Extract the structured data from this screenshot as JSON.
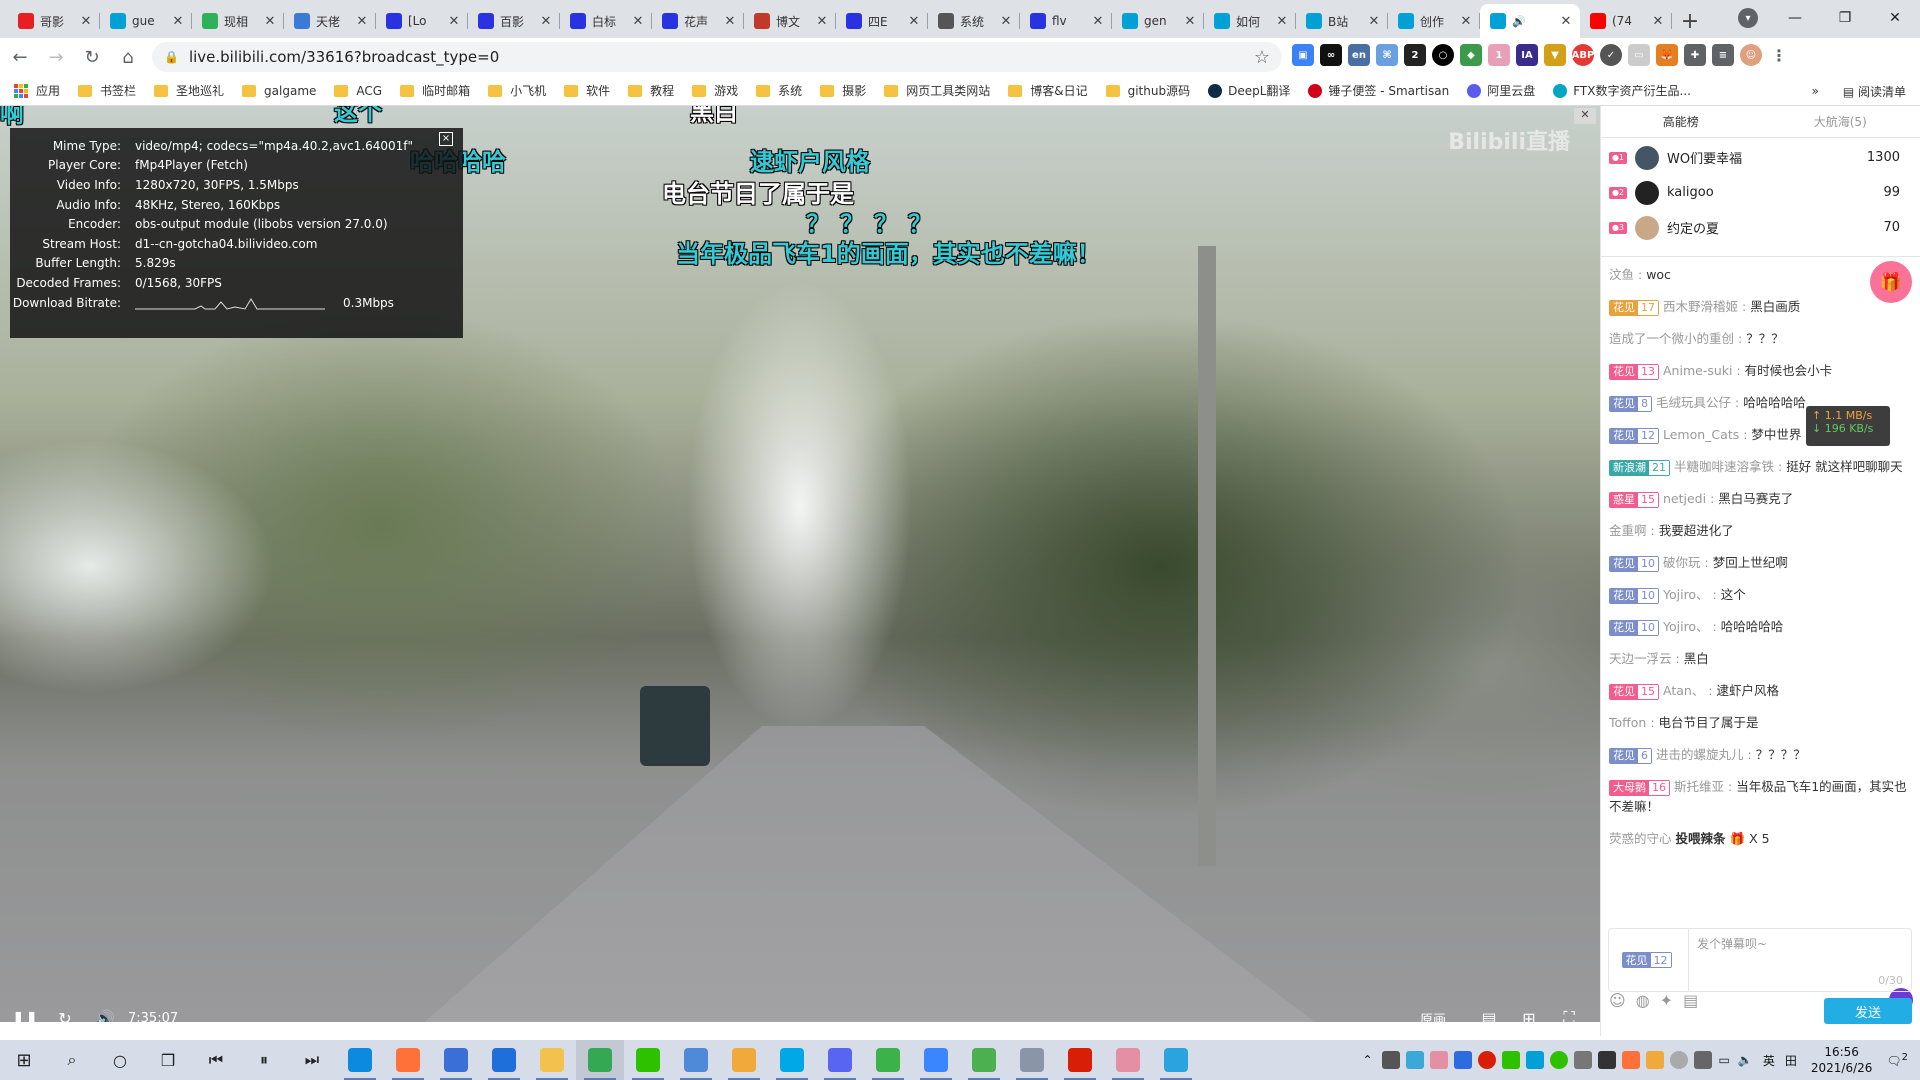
{
  "browser": {
    "tabs": [
      {
        "title": "哥影",
        "favicon": "#e81e25"
      },
      {
        "title": "gue",
        "favicon": "#00a1d6"
      },
      {
        "title": "现相",
        "favicon": "#2fb15b"
      },
      {
        "title": "天佬",
        "favicon": "#3a7bd5"
      },
      {
        "title": "[Lo",
        "favicon": "#2932e1"
      },
      {
        "title": "百影",
        "favicon": "#2932e1"
      },
      {
        "title": "白标",
        "favicon": "#2932e1"
      },
      {
        "title": "花声",
        "favicon": "#2932e1"
      },
      {
        "title": "博文",
        "favicon": "#c0392b"
      },
      {
        "title": "四E",
        "favicon": "#2932e1"
      },
      {
        "title": "系统",
        "favicon": "#555555"
      },
      {
        "title": "flv",
        "favicon": "#2932e1"
      },
      {
        "title": "gen",
        "favicon": "#00a1d6"
      },
      {
        "title": "如何",
        "favicon": "#00a1d6"
      },
      {
        "title": "B站",
        "favicon": "#00a1d6"
      },
      {
        "title": "创作",
        "favicon": "#00a1d6"
      },
      {
        "title": "",
        "favicon": "#00a1d6",
        "active": true
      },
      {
        "title": "(74",
        "favicon": "#ff0000"
      }
    ],
    "url": "live.bilibili.com/33616?broadcast_type=0",
    "extension_badges": [
      "en",
      "2",
      "1"
    ],
    "bookmarks": [
      {
        "label": "应用",
        "type": "apps"
      },
      {
        "label": "书签栏",
        "type": "folder"
      },
      {
        "label": "圣地巡礼",
        "type": "folder"
      },
      {
        "label": "galgame",
        "type": "folder"
      },
      {
        "label": "ACG",
        "type": "folder"
      },
      {
        "label": "临时邮箱",
        "type": "folder"
      },
      {
        "label": "小飞机",
        "type": "folder"
      },
      {
        "label": "软件",
        "type": "folder"
      },
      {
        "label": "教程",
        "type": "folder"
      },
      {
        "label": "游戏",
        "type": "folder"
      },
      {
        "label": "系统",
        "type": "folder"
      },
      {
        "label": "摄影",
        "type": "folder"
      },
      {
        "label": "网页工具类网站",
        "type": "folder"
      },
      {
        "label": "博客&日记",
        "type": "folder"
      },
      {
        "label": "github源码",
        "type": "folder"
      },
      {
        "label": "DeepL翻译",
        "type": "site",
        "color": "#0f2b46"
      },
      {
        "label": "锤子便签 - Smartisan",
        "type": "site",
        "color": "#d0021b"
      },
      {
        "label": "阿里云盘",
        "type": "site",
        "color": "#5b5bf0"
      },
      {
        "label": "FTX数字资产衍生品...",
        "type": "site",
        "color": "#02a6c2"
      }
    ],
    "reading_list_label": "阅读清单",
    "more_label": "»"
  },
  "player": {
    "stats": [
      {
        "key": "Mime Type:",
        "value": "video/mp4; codecs=\"mp4a.40.2,avc1.64001f\""
      },
      {
        "key": "Player Core:",
        "value": "fMp4Player (Fetch)"
      },
      {
        "key": "Video Info:",
        "value": "1280x720, 30FPS, 1.5Mbps"
      },
      {
        "key": "Audio Info:",
        "value": "48KHz, Stereo, 160Kbps"
      },
      {
        "key": "Encoder:",
        "value": "obs-output module (libobs version 27.0.0)"
      },
      {
        "key": "Stream Host:",
        "value": "d1--cn-gotcha04.bilivideo.com"
      },
      {
        "key": "Buffer Length:",
        "value": "5.829s"
      },
      {
        "key": "Decoded Frames:",
        "value": "0/1568, 30FPS"
      }
    ],
    "download_bitrate_label": "Download Bitrate:",
    "download_bitrate_value": "0.3Mbps",
    "stats_close": "[x]",
    "watermark": "Bilibili直播",
    "danmaku": [
      {
        "text": "啊",
        "color": "cyan"
      },
      {
        "text": "这个",
        "color": "cyan"
      },
      {
        "text": "黑白",
        "color": "white"
      },
      {
        "text": "哈哈哈哈",
        "color": "cyan"
      },
      {
        "text": "逮虾户风格",
        "color": "cyan"
      },
      {
        "text": "电台节目了属于是",
        "color": "white"
      },
      {
        "text": "？？？？",
        "color": "cyan"
      },
      {
        "text": "当年极品飞车1的画面，其实也不差嘛！",
        "color": "cyan"
      }
    ],
    "time": "7:35:07",
    "quality_label": "原画"
  },
  "side_panel": {
    "rank_tabs": [
      "高能榜",
      "大航海(5)"
    ],
    "rank": [
      {
        "name": "WO们要幸福",
        "score": "1300",
        "avatar": "#445566"
      },
      {
        "name": "kaligoo",
        "score": "99",
        "avatar": "#222222"
      },
      {
        "name": "约定の夏",
        "score": "70",
        "avatar": "#c9a88a"
      }
    ],
    "messages": [
      {
        "user": "汶鱼",
        "text": "woc"
      },
      {
        "medal": "花见",
        "level": "17",
        "medal_style": "orange",
        "user": "西木野滑稽姬",
        "text": "黑白画质"
      },
      {
        "user": "造成了一个微小的重创",
        "text": "？？？"
      },
      {
        "medal": "花见",
        "level": "13",
        "medal_style": "pink",
        "user": "Anime-suki",
        "text": "有时候也会小卡"
      },
      {
        "medal": "花见",
        "level": "8",
        "medal_style": "blue",
        "user": "毛绒玩具公仔",
        "text": "哈哈哈哈哈"
      },
      {
        "medal": "花见",
        "level": "12",
        "medal_style": "blue",
        "user": "Lemon_Cats",
        "text": "梦中世界"
      },
      {
        "medal": "新浪潮",
        "level": "21",
        "medal_style": "teal",
        "user": "半糖咖啡速溶拿铁",
        "text": "挺好 就这样吧聊聊天"
      },
      {
        "medal": "惑星",
        "level": "15",
        "medal_style": "pink",
        "user": "netjedi",
        "text": "黑白马赛克了"
      },
      {
        "user": "金重啊",
        "text": "我要超进化了"
      },
      {
        "medal": "花见",
        "level": "10",
        "medal_style": "blue",
        "user": "破你玩",
        "text": "梦回上世纪啊"
      },
      {
        "medal": "花见",
        "level": "10",
        "medal_style": "blue",
        "user": "Yojiro、",
        "text": "这个"
      },
      {
        "medal": "花见",
        "level": "10",
        "medal_style": "blue",
        "user": "Yojiro、",
        "text": "哈哈哈哈哈"
      },
      {
        "user": "天边一浮云",
        "text": "黑白"
      },
      {
        "medal": "花见",
        "level": "15",
        "medal_style": "pink",
        "user": "Atan、",
        "text": "逮虾户风格"
      },
      {
        "user": "Toffon",
        "text": "电台节目了属于是"
      },
      {
        "medal": "花见",
        "level": "6",
        "medal_style": "blue",
        "user": "进击的螺旋丸儿",
        "text": "？？？？"
      },
      {
        "medal": "大母鹅",
        "level": "16",
        "medal_style": "pink",
        "user": "斯托维亚",
        "text": "当年极品飞车1的画面，其实也不差嘛！"
      }
    ],
    "gift": {
      "user": "荧惑的守心",
      "action": "投喂辣条",
      "count": "X 5"
    },
    "speed": {
      "up": "↑ 1.1 MB/s",
      "down": "↓ 196 KB/s"
    },
    "input": {
      "medal": "花见",
      "level": "12",
      "placeholder": "发个弹幕呗~",
      "counter": "0/30"
    },
    "send_label": "发送"
  },
  "taskbar": {
    "time": "16:56",
    "date": "2021/6/26",
    "ime": "英",
    "notifications": "2",
    "apps": [
      {
        "name": "edge",
        "color": "#0c8ae0"
      },
      {
        "name": "firefox",
        "color": "#ff7139"
      },
      {
        "name": "store",
        "color": "#3a6fd8"
      },
      {
        "name": "mail",
        "color": "#1e6fd9"
      },
      {
        "name": "explorer",
        "color": "#f2c14e"
      },
      {
        "name": "chrome",
        "color": "#34a853"
      },
      {
        "name": "wechat",
        "color": "#2dc100"
      },
      {
        "name": "app-blue",
        "color": "#4f8ad8"
      },
      {
        "name": "app-cat",
        "color": "#f2a93b"
      },
      {
        "name": "app-search",
        "color": "#00a8e8"
      },
      {
        "name": "discord",
        "color": "#5865f2"
      },
      {
        "name": "app-green",
        "color": "#3bb34a"
      },
      {
        "name": "app-note",
        "color": "#3a86ff"
      },
      {
        "name": "app-pal",
        "color": "#4caf50"
      },
      {
        "name": "app-gray",
        "color": "#8a96a8"
      },
      {
        "name": "netease",
        "color": "#d81e06"
      },
      {
        "name": "app-anime",
        "color": "#e58fa5"
      },
      {
        "name": "telegram",
        "color": "#2aa3df"
      }
    ]
  }
}
